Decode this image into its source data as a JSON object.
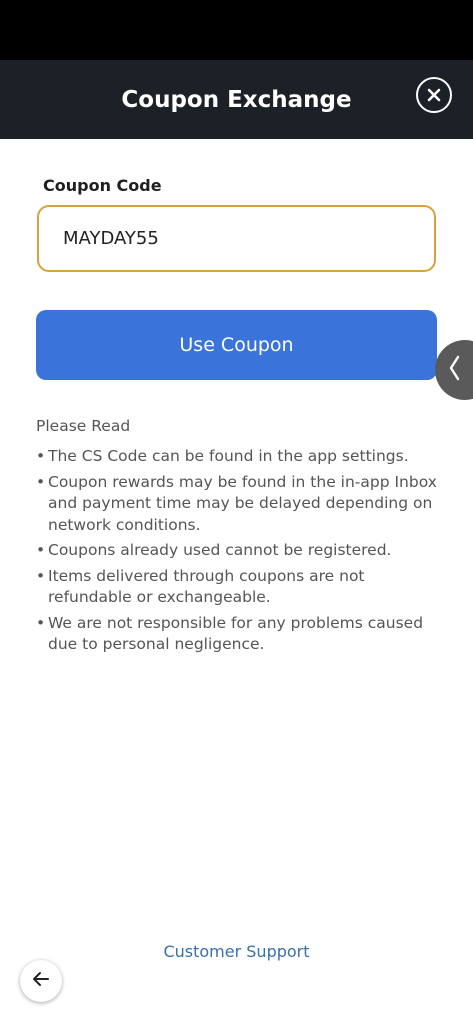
{
  "header": {
    "title": "Coupon Exchange",
    "close_icon": "close-icon"
  },
  "form": {
    "label": "Coupon Code",
    "input_value": "MAYDAY55",
    "input_border_color": "#d9a23b",
    "button_label": "Use Coupon",
    "button_color": "#3a73d9"
  },
  "side_tab": {
    "icon": "chevron-left-icon",
    "glyph": "❬"
  },
  "notice": {
    "title": "Please Read",
    "bullet": "•",
    "items": [
      "The CS Code can be found in the app settings.",
      "Coupon rewards may be found in the in-app Inbox and payment time may be delayed depending on network conditions.",
      "Coupons already used cannot be registered.",
      "Items delivered through coupons are not refundable or exchangeable.",
      "We are not responsible for any problems caused due to personal negligence."
    ]
  },
  "footer": {
    "support_link": "Customer Support",
    "back_icon": "back-arrow-icon"
  },
  "colors": {
    "header_bg": "#1c2027",
    "status_bar_bg": "#000000",
    "link": "#3b6fa8"
  }
}
